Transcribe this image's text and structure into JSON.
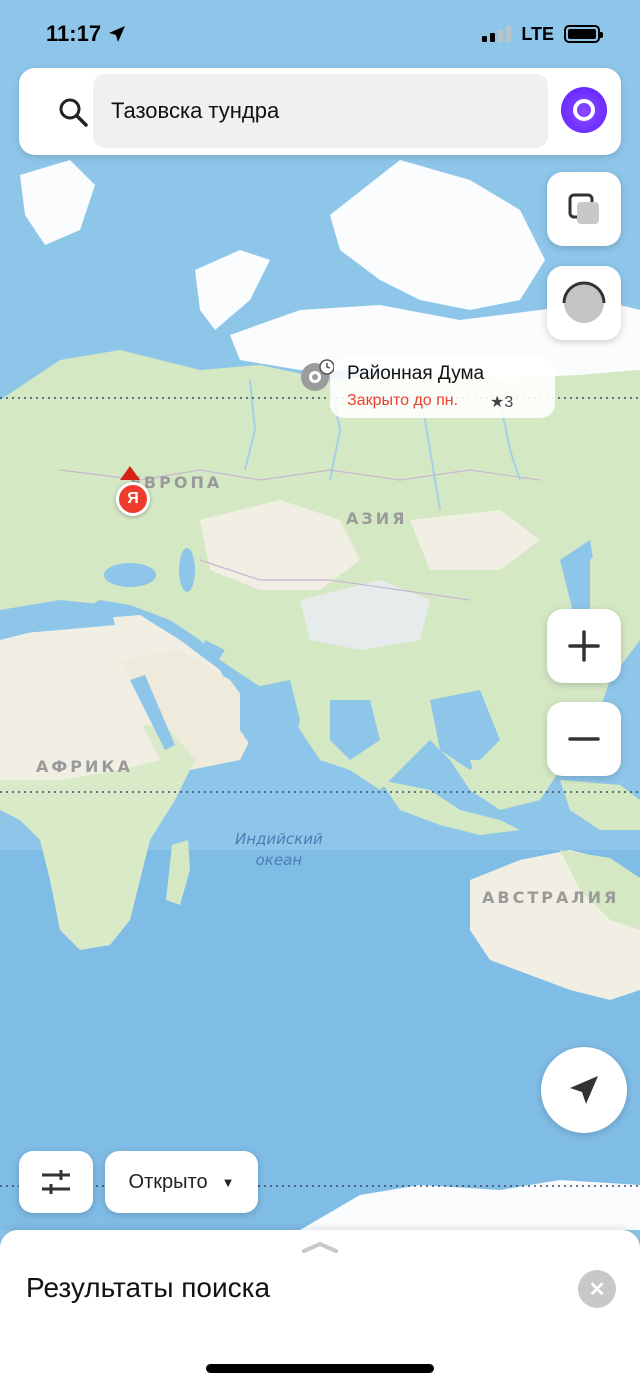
{
  "status_bar": {
    "time": "11:17",
    "network": "LTE"
  },
  "search": {
    "query": "Тазовска тундра"
  },
  "map": {
    "continent_labels": {
      "europe": "ЕВРОПА",
      "asia": "АЗИЯ",
      "africa": "АФРИКА",
      "australia": "АВСТРАЛИЯ"
    },
    "ocean_label": "Индийский\nокеан",
    "place": {
      "name": "Районная Дума",
      "status": "Закрыто до пн.",
      "rating": "★3"
    },
    "marker_letter": "Я",
    "colors": {
      "water": "#8ec6ea",
      "land": "#d5e8c4",
      "desert": "#f1efe4",
      "ice": "#fafcfe",
      "accent": "#ef3b2c"
    }
  },
  "controls": {
    "open_filter_label": "Открыто",
    "icons": [
      "search-icon",
      "alice-icon",
      "layers-icon",
      "sphere-icon",
      "plus-icon",
      "minus-icon",
      "location-arrow-icon",
      "filter-sliders-icon",
      "chevron-up-icon",
      "close-icon"
    ]
  },
  "bottom_sheet": {
    "title": "Результаты поиска",
    "close_symbol": "✕"
  }
}
